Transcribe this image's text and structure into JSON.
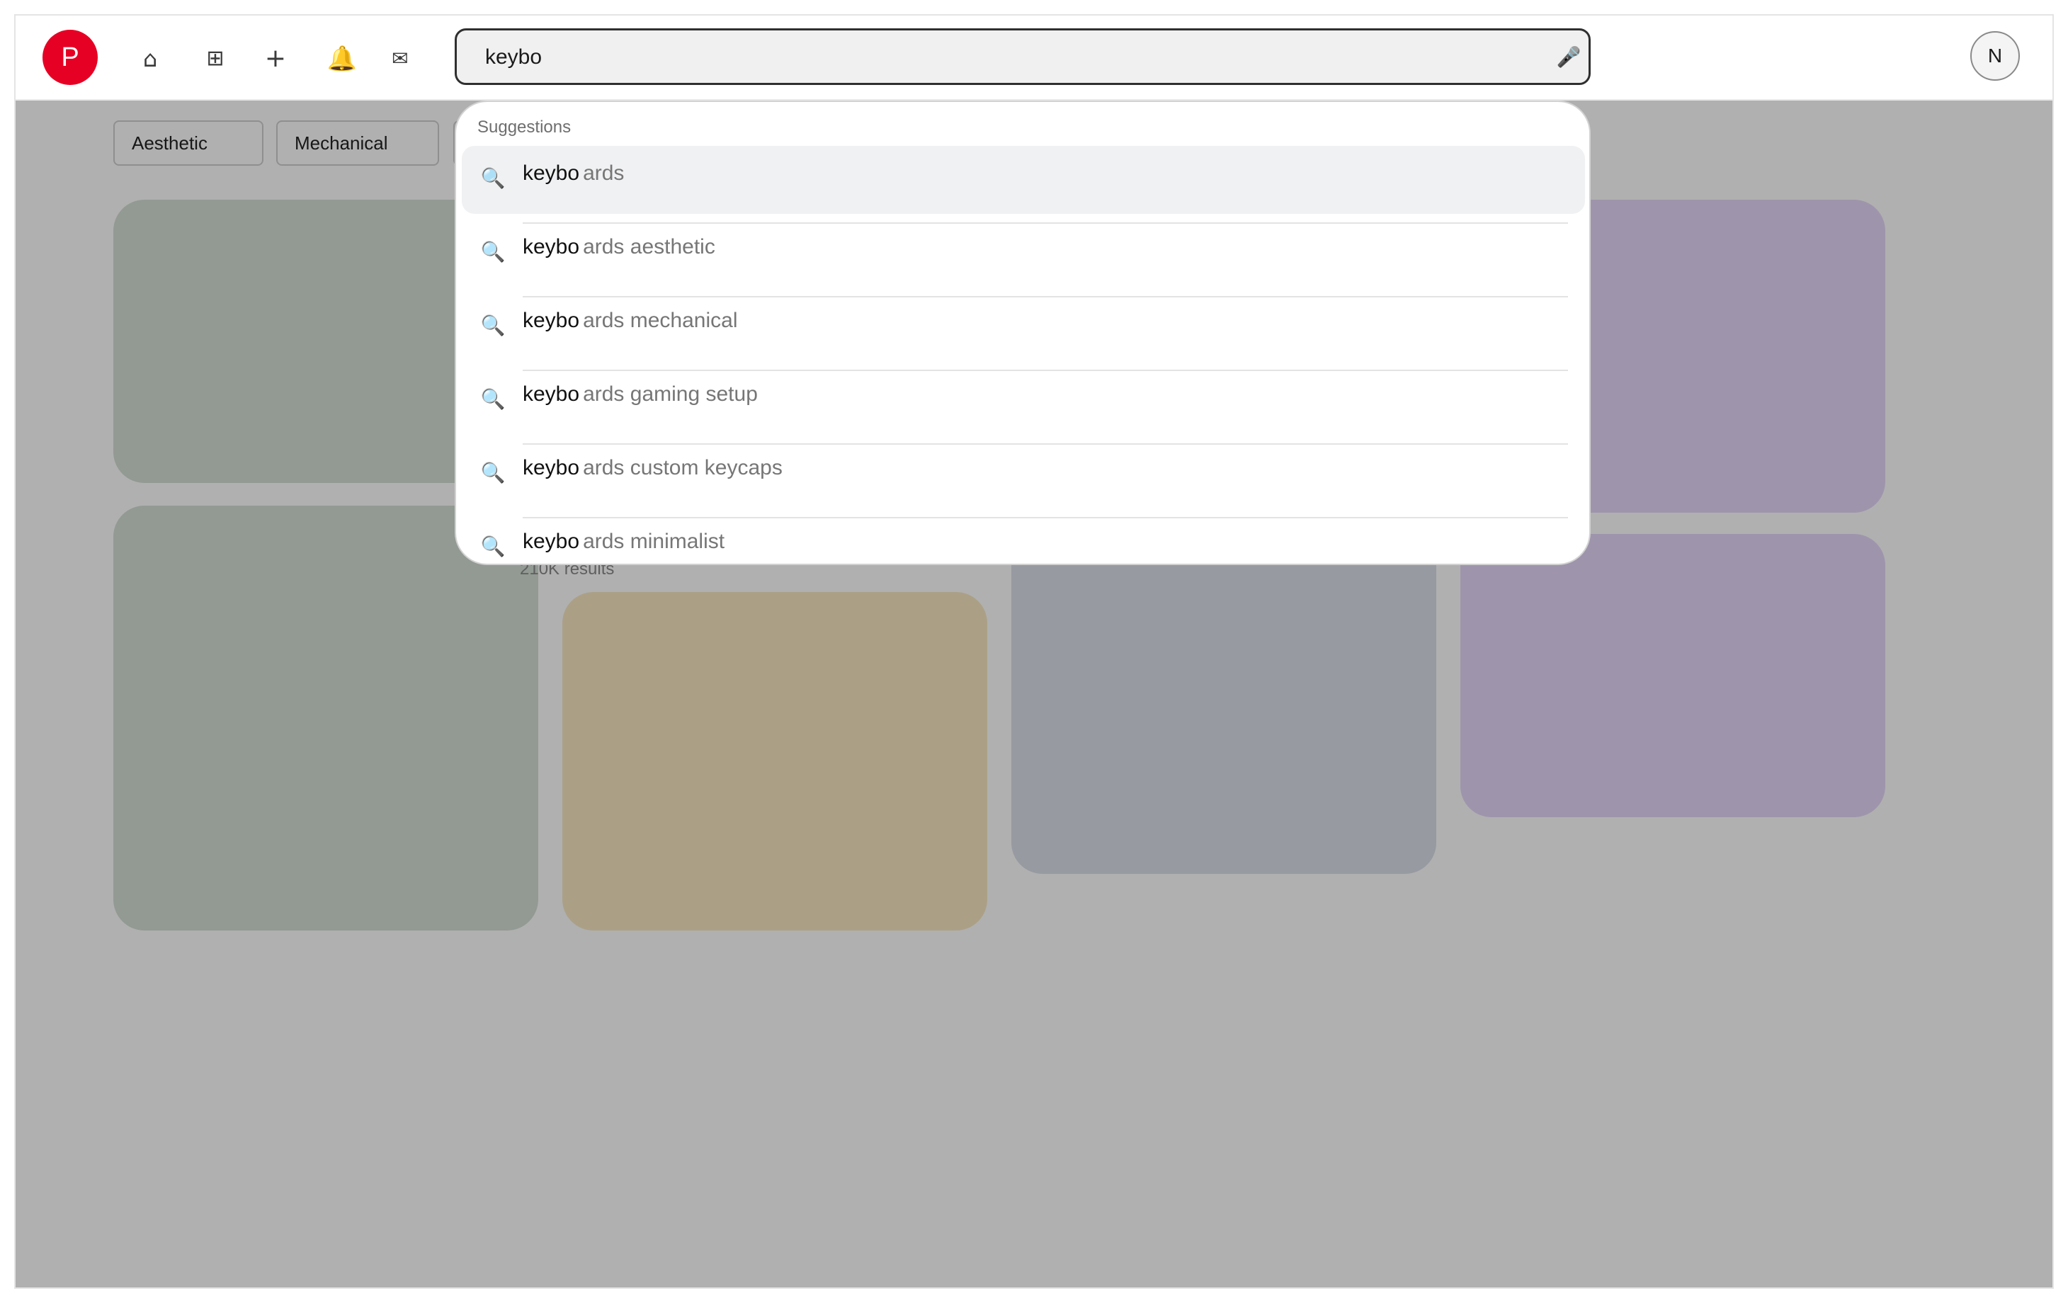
{
  "header": {
    "logo_letter": "P",
    "nav": {
      "home_icon": "home-icon",
      "home_glyph": "⌂",
      "grid_icon": "grid-icon",
      "grid_glyph": "⊞",
      "create_icon": "plus-icon",
      "create_glyph": "+",
      "notifications_icon": "bell-icon",
      "notifications_glyph": "🔔",
      "messages_icon": "mail-icon",
      "messages_glyph": "✉"
    },
    "search": {
      "value": "keybo",
      "mic_icon": "microphone-icon",
      "mic_glyph": "🎤"
    },
    "avatar_initial": "N"
  },
  "filters": {
    "chips": [
      "Aesthetic",
      "Mechanical"
    ]
  },
  "results_count": "210K results",
  "pins": {
    "colors": [
      "#d4dfd5",
      "#d4dfd5",
      "#f8e8c3",
      "#dbe0e9",
      "#e5d8fa",
      "#e5d8fa"
    ]
  },
  "suggestions": {
    "heading": "Suggestions",
    "search_glyph": "🔍",
    "items": [
      {
        "typed": "keybo",
        "rest": "ards"
      },
      {
        "typed": "keybo",
        "rest": "ards aesthetic"
      },
      {
        "typed": "keybo",
        "rest": "ards mechanical"
      },
      {
        "typed": "keybo",
        "rest": "ards gaming setup"
      },
      {
        "typed": "keybo",
        "rest": "ards custom keycaps"
      },
      {
        "typed": "keybo",
        "rest": "ards minimalist"
      }
    ]
  },
  "colors": {
    "brand": "#e60023",
    "overlay": "rgba(0,0,0,0.31)",
    "active_row": "#f0f1f2"
  }
}
